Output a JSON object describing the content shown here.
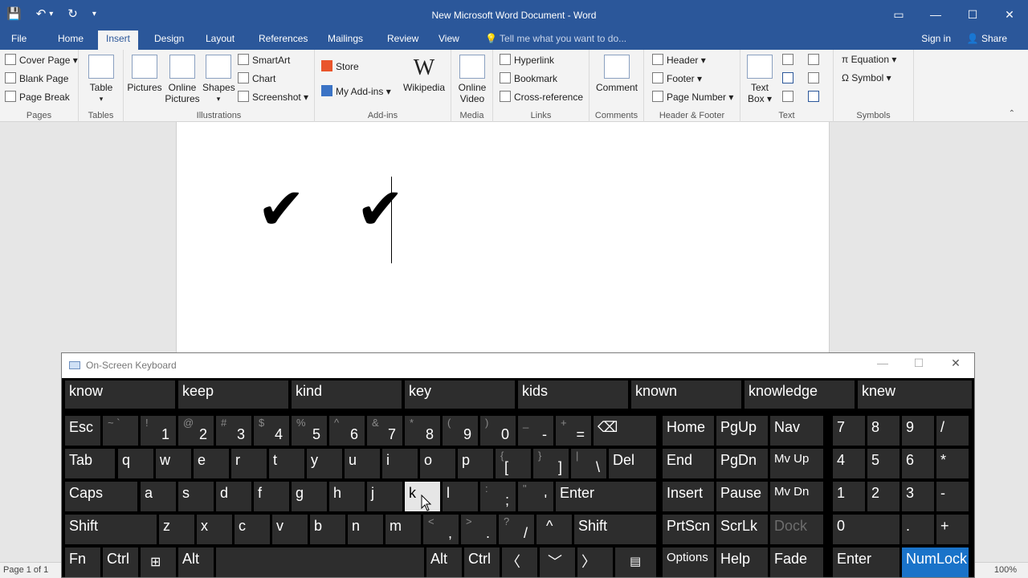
{
  "window": {
    "title": "New Microsoft Word Document - Word",
    "qat": {
      "save": "💾",
      "undo": "↶",
      "undo_more": "▾",
      "redo": "↻",
      "customize": "▾"
    },
    "controls": {
      "ribbon_display": "▭",
      "minimize": "—",
      "maximize": "☐",
      "close": "✕"
    }
  },
  "tabs": {
    "file": "File",
    "home": "Home",
    "insert": "Insert",
    "design": "Design",
    "layout": "Layout",
    "references": "References",
    "mailings": "Mailings",
    "review": "Review",
    "view": "View",
    "tellme": "💡 Tell me what you want to do...",
    "signin": "Sign in",
    "share": "👤 Share"
  },
  "ribbon": {
    "pages": {
      "label": "Pages",
      "cover": "Cover Page ▾",
      "blank": "Blank Page",
      "break": "Page Break"
    },
    "tables": {
      "label": "Tables",
      "table": "Table",
      "table_more": "▾"
    },
    "illustrations": {
      "label": "Illustrations",
      "pictures": "Pictures",
      "online_pictures_1": "Online",
      "online_pictures_2": "Pictures",
      "shapes": "Shapes",
      "shapes_more": "▾",
      "smartart": "SmartArt",
      "chart": "Chart",
      "screenshot": "Screenshot ▾"
    },
    "addins": {
      "label": "Add-ins",
      "store": "Store",
      "myaddins": "My Add-ins  ▾",
      "wikipedia": "Wikipedia",
      "wiki_glyph": "W"
    },
    "media": {
      "label": "Media",
      "video1": "Online",
      "video2": "Video"
    },
    "links": {
      "label": "Links",
      "hyperlink": "Hyperlink",
      "bookmark": "Bookmark",
      "crossref": "Cross-reference"
    },
    "comments": {
      "label": "Comments",
      "comment": "Comment"
    },
    "headerfooter": {
      "label": "Header & Footer",
      "header": "Header ▾",
      "footer": "Footer ▾",
      "pagenumber": "Page Number ▾"
    },
    "text": {
      "label": "Text",
      "textbox1": "Text",
      "textbox2": "Box ▾"
    },
    "symbols": {
      "label": "Symbols",
      "equation": "π  Equation  ▾",
      "symbol": "Ω  Symbol ▾"
    },
    "collapse": "⌃"
  },
  "document": {
    "content": "✔ ✔"
  },
  "status": {
    "page": "Page 1 of 1",
    "zoom": "100%"
  },
  "osk": {
    "title": "On-Screen Keyboard",
    "controls": {
      "min": "—",
      "max": "☐",
      "close": "✕"
    },
    "suggestions": [
      "know",
      "keep",
      "kind",
      "key",
      "kids",
      "known",
      "knowledge",
      "knew"
    ],
    "keys": {
      "esc": "Esc",
      "tilde_s": "~ `",
      "n1_s": "!",
      "n1": "1",
      "n2_s": "@",
      "n2": "2",
      "n3_s": "#",
      "n3": "3",
      "n4_s": "$",
      "n4": "4",
      "n5_s": "%",
      "n5": "5",
      "n6_s": "^",
      "n6": "6",
      "n7_s": "&",
      "n7": "7",
      "n8_s": "*",
      "n8": "8",
      "n9_s": "(",
      "n9": "9",
      "n0_s": ")",
      "n0": "0",
      "minus_s": "_",
      "minus": "-",
      "eq_s": "+",
      "eq": "=",
      "bksp": "⌫",
      "tab": "Tab",
      "q": "q",
      "w": "w",
      "e": "e",
      "r": "r",
      "t": "t",
      "y": "y",
      "u": "u",
      "i": "i",
      "o": "o",
      "p": "p",
      "lbr_s": "{",
      "lbr": "[",
      "rbr_s": "}",
      "rbr": "]",
      "bsl_s": "|",
      "bsl": "\\",
      "del": "Del",
      "caps": "Caps",
      "a": "a",
      "s": "s",
      "d": "d",
      "f": "f",
      "g": "g",
      "h": "h",
      "j": "j",
      "k": "k",
      "l": "l",
      "semi_s": ":",
      "semi": ";",
      "quote_s": "\"",
      "quote": "'",
      "enter": "Enter",
      "shift": "Shift",
      "z": "z",
      "x": "x",
      "c": "c",
      "v": "v",
      "b": "b",
      "n": "n",
      "m": "m",
      "comma_s": "<",
      "comma": ",",
      "dot_s": ">",
      "dot": ".",
      "slash_s": "?",
      "slash": "/",
      "up": "^",
      "rshift": "Shift",
      "fn": "Fn",
      "ctrl": "Ctrl",
      "win": "⊞",
      "alt": "Alt",
      "space": "",
      "ralt": "Alt",
      "rctrl": "Ctrl",
      "left": "〈",
      "down": "﹀",
      "right": "〉",
      "menu": "▤",
      "home": "Home",
      "pgup": "PgUp",
      "nav": "Nav",
      "end": "End",
      "pgdn": "PgDn",
      "mvup": "Mv Up",
      "insert": "Insert",
      "pause": "Pause",
      "mvdn": "Mv Dn",
      "prtscn": "PrtScn",
      "scrlk": "ScrLk",
      "dock": "Dock",
      "options": "Options",
      "help": "Help",
      "fade": "Fade",
      "np7": "7",
      "np8": "8",
      "np9": "9",
      "npdiv": "/",
      "np4": "4",
      "np5": "5",
      "np6": "6",
      "npmul": "*",
      "np1": "1",
      "np2": "2",
      "np3": "3",
      "npsub": "-",
      "np0": "0",
      "npdot": ".",
      "npadd": "+",
      "npenter": "Enter",
      "numlock": "NumLock"
    }
  }
}
